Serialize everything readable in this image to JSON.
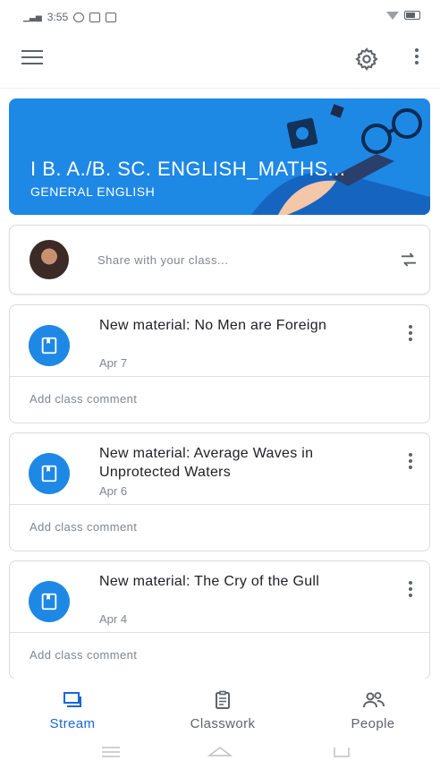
{
  "status_bar": {
    "time": "3:55"
  },
  "banner": {
    "title": "I B. A./B. SC. ENGLISH_MATHS...",
    "subtitle": "GENERAL ENGLISH"
  },
  "share": {
    "placeholder": "Share with your class..."
  },
  "posts": [
    {
      "title": "New material: No Men are Foreign",
      "date": "Apr 7",
      "comment": "Add class comment"
    },
    {
      "title": "New material: Average Waves in Unprotected Waters",
      "date": "Apr 6",
      "comment": "Add class comment"
    },
    {
      "title": "New material: The Cry of the Gull",
      "date": "Apr 4",
      "comment": "Add class comment"
    }
  ],
  "bottom_nav": {
    "items": [
      {
        "label": "Stream",
        "icon": "stream-icon",
        "active": true
      },
      {
        "label": "Classwork",
        "icon": "classwork-icon",
        "active": false
      },
      {
        "label": "People",
        "icon": "people-icon",
        "active": false
      }
    ]
  },
  "colors": {
    "accent": "#1e88e5",
    "active_nav": "#1967d2"
  }
}
